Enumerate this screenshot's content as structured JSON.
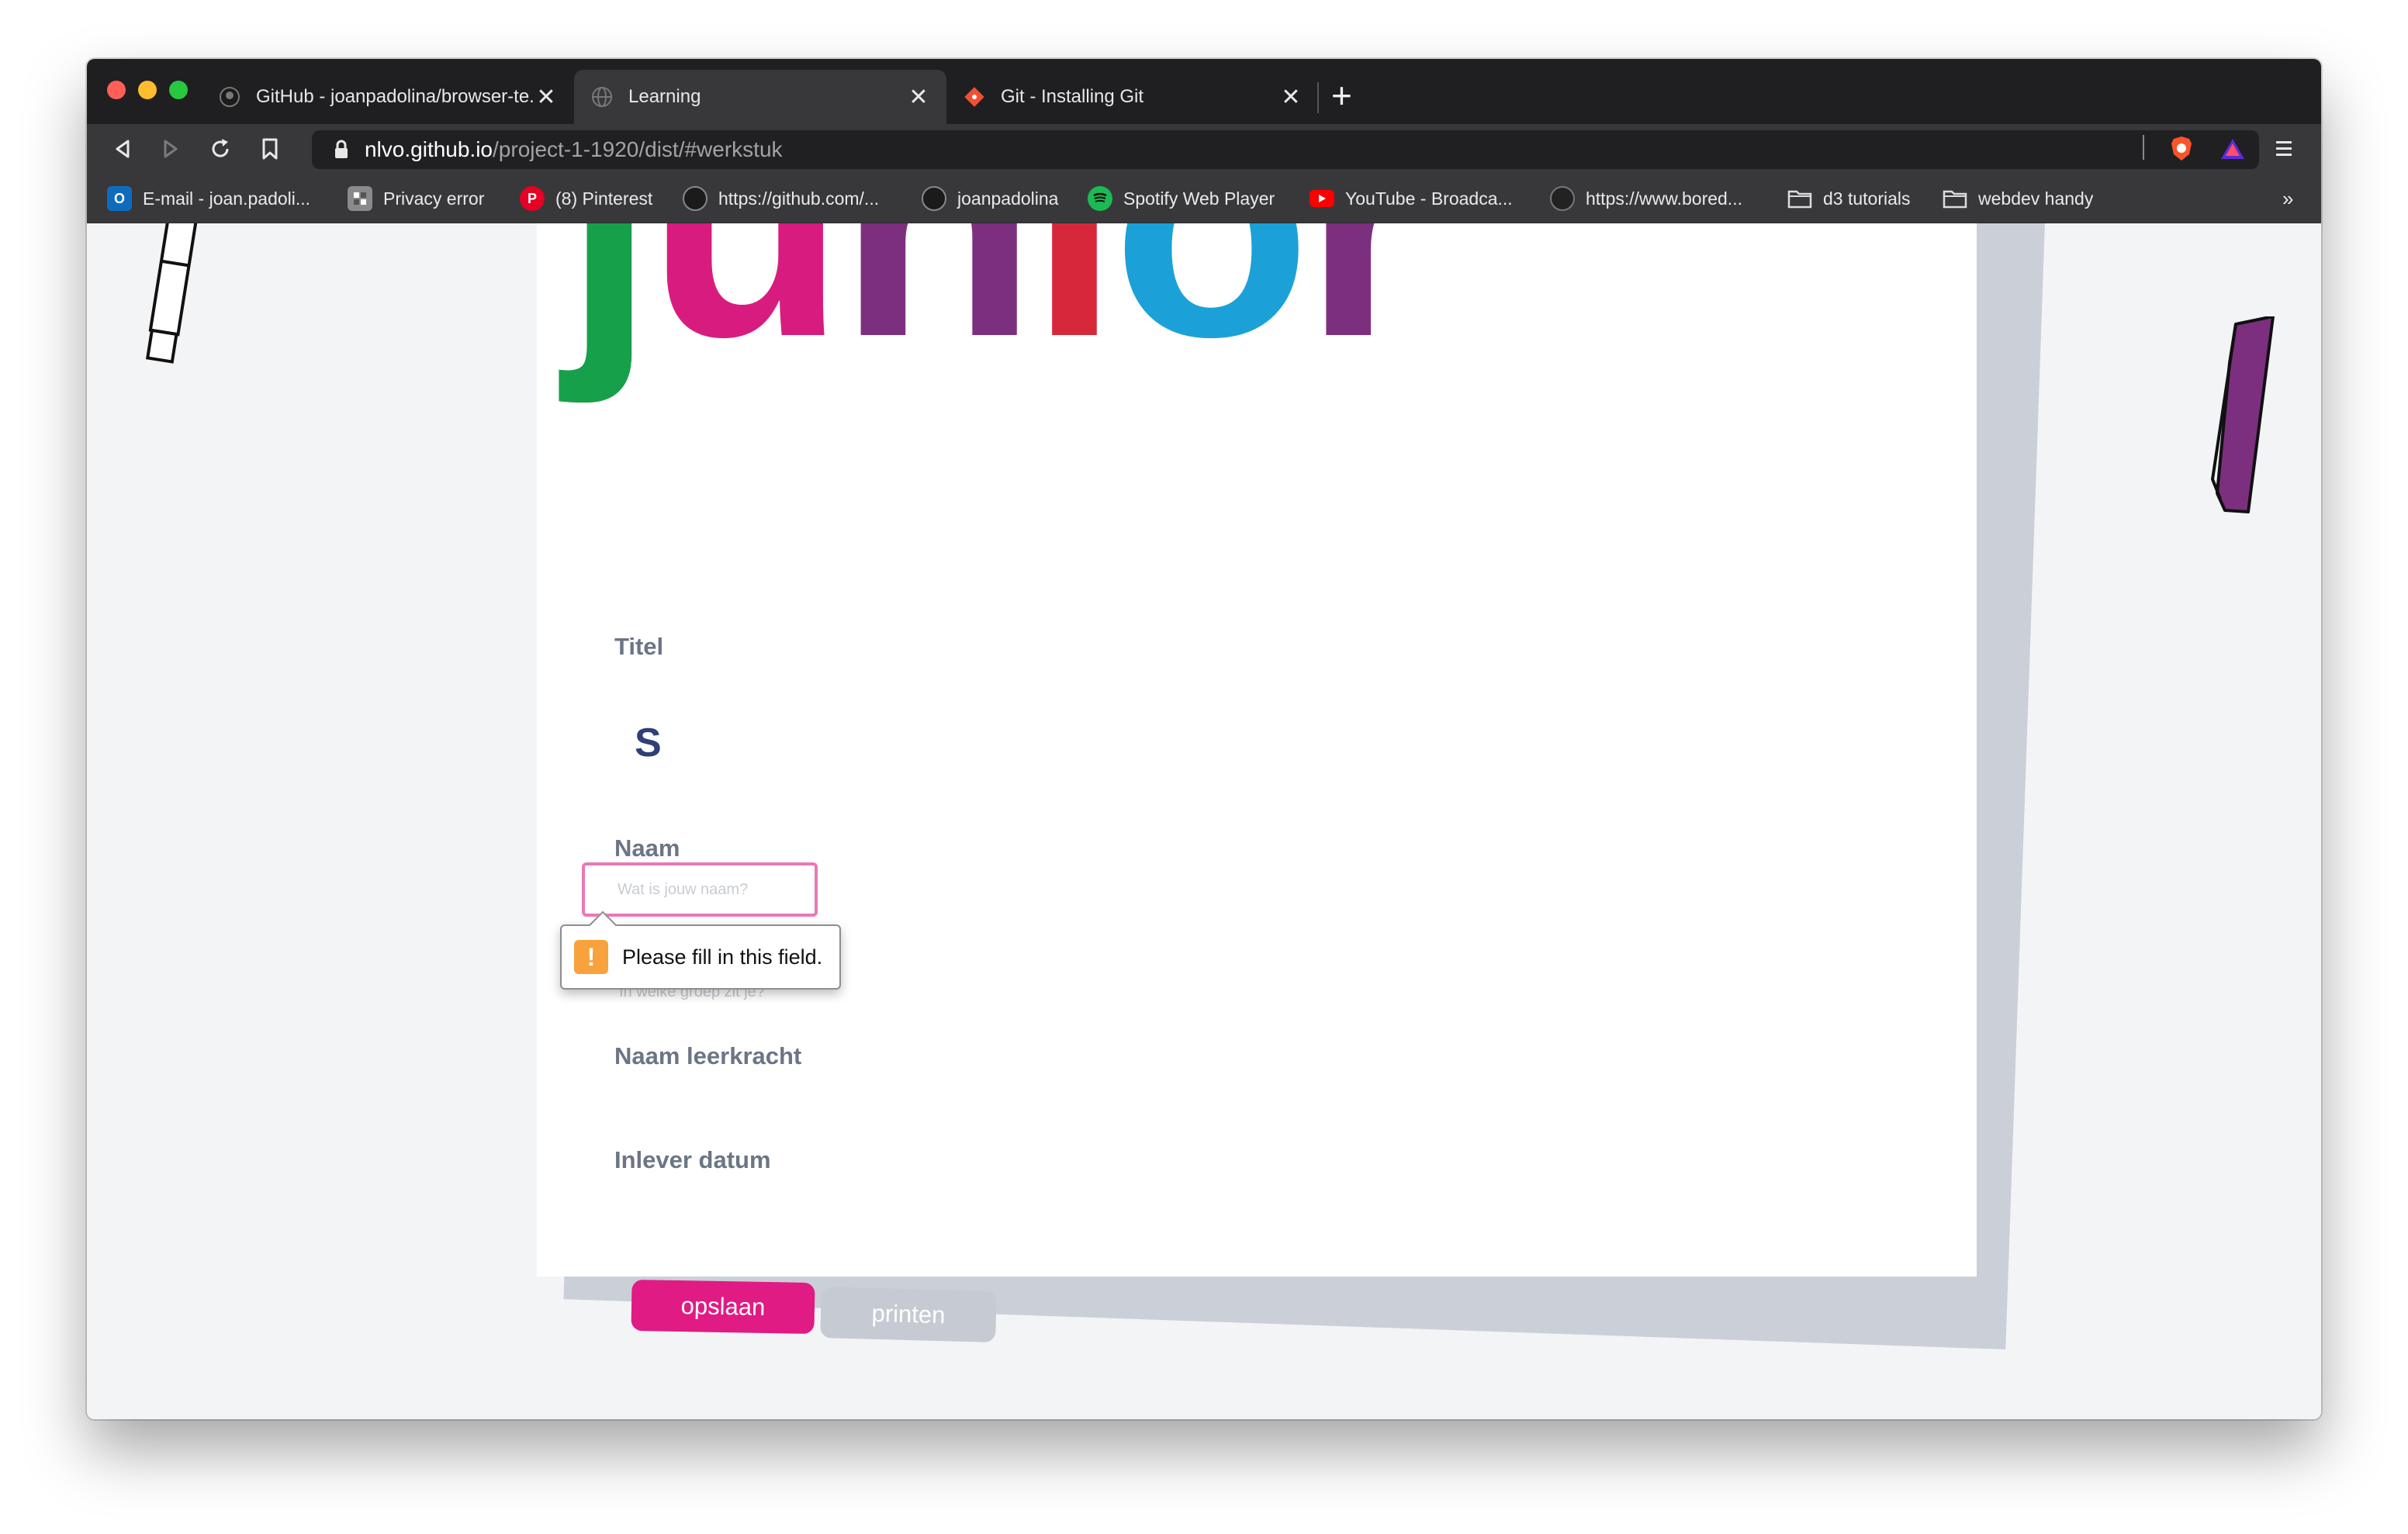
{
  "browser": {
    "tabs": [
      {
        "title": "GitHub - joanpadolina/browser-te...",
        "icon": "github-icon",
        "active": false
      },
      {
        "title": "Learning",
        "icon": "globe-icon",
        "active": true
      },
      {
        "title": "Git - Installing Git",
        "icon": "git-icon",
        "active": false
      }
    ],
    "close_glyph": "✕",
    "new_tab_glyph": "+",
    "url_host": "nlvo.github.io",
    "url_path": "/project-1-1920/dist/#werkstuk",
    "bookmarks": [
      {
        "label": "E-mail - joan.padoli...",
        "icon": "outlook-icon",
        "color": "#0f6cbd"
      },
      {
        "label": "Privacy error",
        "icon": "page-icon",
        "color": "#8a8a8a"
      },
      {
        "label": "(8) Pinterest",
        "icon": "pinterest-icon",
        "color": "#e60023"
      },
      {
        "label": "https://github.com/...",
        "icon": "github-icon",
        "color": "#333333"
      },
      {
        "label": "joanpadolina",
        "icon": "github-icon",
        "color": "#333333"
      },
      {
        "label": "Spotify Web Player",
        "icon": "spotify-icon",
        "color": "#1db954"
      },
      {
        "label": "YouTube - Broadca...",
        "icon": "youtube-icon",
        "color": "#ff0000"
      },
      {
        "label": "https://www.bored...",
        "icon": "panda-icon",
        "color": "#222222"
      },
      {
        "label": "d3 tutorials",
        "icon": "folder-icon",
        "color": "#cccccc"
      },
      {
        "label": "webdev handy",
        "icon": "folder-icon",
        "color": "#cccccc"
      }
    ],
    "bookmarks_overflow": "»"
  },
  "page": {
    "heading_letters": [
      {
        "ch": "j",
        "color": "#17a04a"
      },
      {
        "ch": "u",
        "color": "#d81b7f"
      },
      {
        "ch": "n",
        "color": "#7d2f7f"
      },
      {
        "ch": "i",
        "color": "#d7283b"
      },
      {
        "ch": "o",
        "color": "#1ba1d8"
      },
      {
        "ch": "r",
        "color": "#7d2f7f"
      }
    ],
    "form": {
      "title_label": "Titel",
      "title_value": "S",
      "name_label": "Naam",
      "name_placeholder": "Wat is jouw naam?",
      "group_placeholder": "In welke groep zit je?",
      "teacher_label": "Naam leerkracht",
      "date_label": "Inlever datum"
    },
    "validation": {
      "icon_glyph": "!",
      "message": "Please fill in this field."
    },
    "buttons": {
      "save": "opslaan",
      "print": "printen"
    }
  },
  "colors": {
    "accent_pink": "#e01b84",
    "input_border": "#e879b8",
    "pen_purple": "#7d2f7f"
  }
}
